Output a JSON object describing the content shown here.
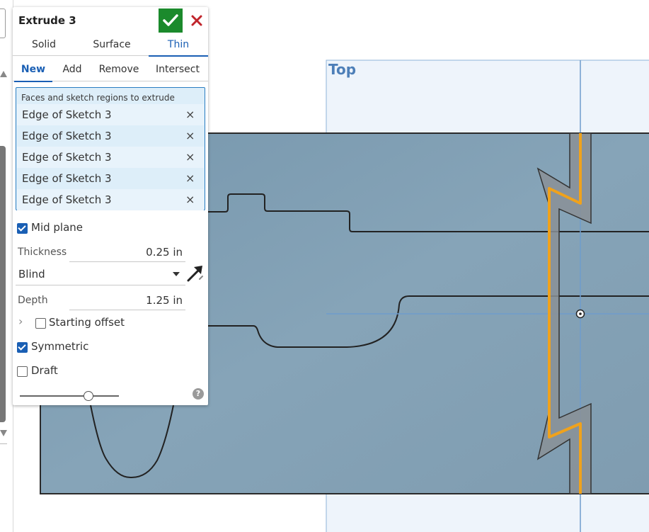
{
  "feature": {
    "title": "Extrude 3",
    "accept_icon": "checkmark-icon",
    "cancel_icon": "close-icon"
  },
  "body_type_tabs": [
    {
      "label": "Solid",
      "active": false
    },
    {
      "label": "Surface",
      "active": false
    },
    {
      "label": "Thin",
      "active": true
    }
  ],
  "operation_tabs": [
    {
      "label": "New",
      "active": true
    },
    {
      "label": "Add",
      "active": false
    },
    {
      "label": "Remove",
      "active": false
    },
    {
      "label": "Intersect",
      "active": false
    }
  ],
  "selection": {
    "label": "Faces and sketch regions to extrude",
    "items": [
      "Edge of Sketch 3",
      "Edge of Sketch 3",
      "Edge of Sketch 3",
      "Edge of Sketch 3",
      "Edge of Sketch 3"
    ],
    "remove_glyph": "×"
  },
  "mid_plane": {
    "label": "Mid plane",
    "checked": true
  },
  "thickness": {
    "label": "Thickness",
    "value": "0.25 in"
  },
  "end_type": {
    "value": "Blind",
    "flip_icon": "flip-direction-arrow-icon"
  },
  "depth": {
    "label": "Depth",
    "value": "1.25 in"
  },
  "starting_offset": {
    "label": "Starting offset",
    "checked": false
  },
  "symmetric": {
    "label": "Symmetric",
    "checked": true
  },
  "draft": {
    "label": "Draft",
    "checked": false
  },
  "help": {
    "glyph": "?"
  },
  "viewport": {
    "plane_label": "Top",
    "colors": {
      "part": "#7f9fb5",
      "sketch_highlight": "#f0a21c",
      "plane_line": "#6f9ccc",
      "preview": "#8a8f94"
    }
  }
}
